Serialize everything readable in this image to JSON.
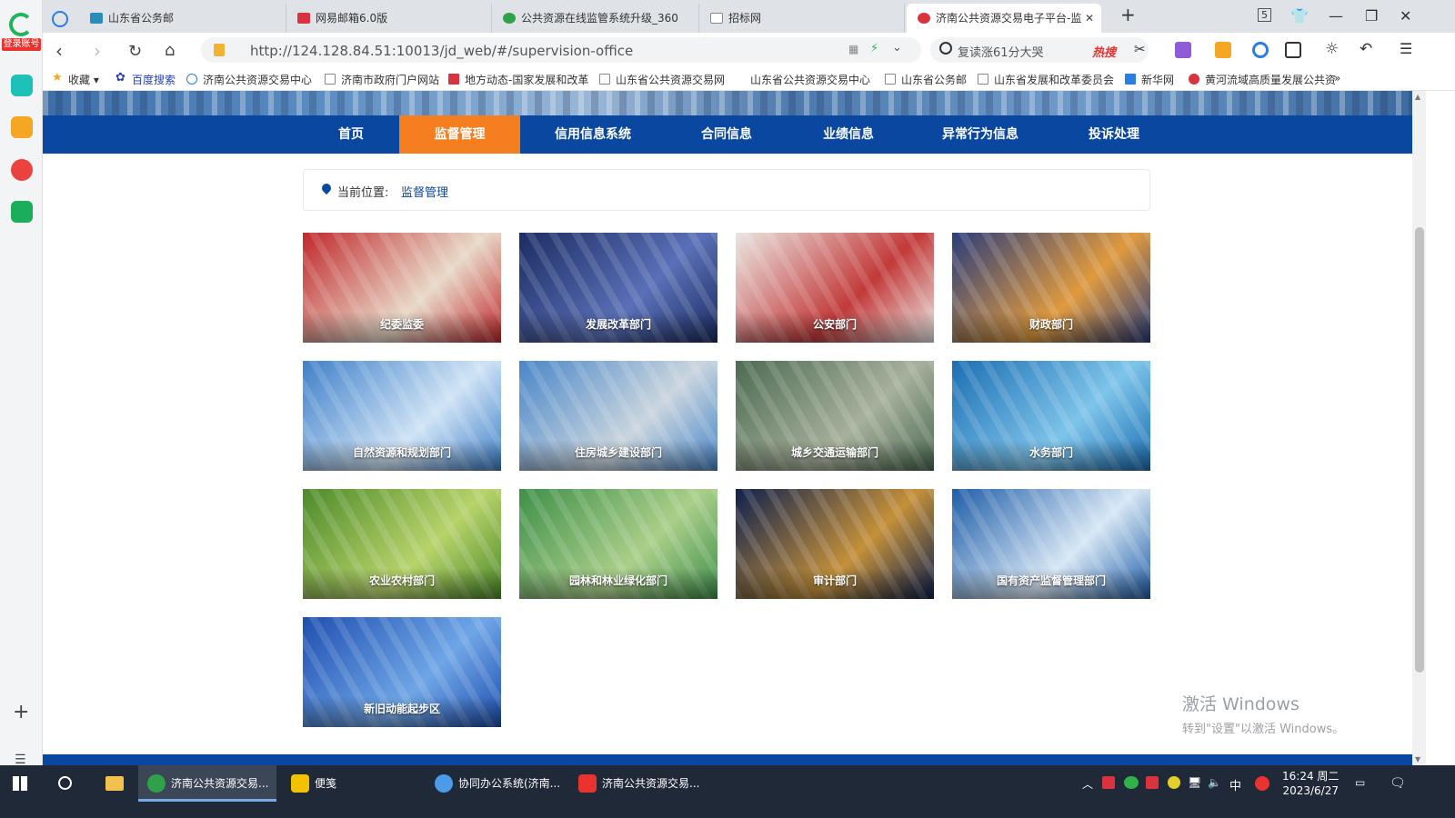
{
  "browser": {
    "login_badge": "登录账号",
    "tabs": [
      {
        "title": "山东省公务邮",
        "active": false,
        "icon_color": "#2a8cb8"
      },
      {
        "title": "网易邮箱6.0版",
        "active": false,
        "icon_color": "#d9333f"
      },
      {
        "title": "公共资源在线监管系统升级_360",
        "active": false,
        "icon_color": "#2fa14a"
      },
      {
        "title": "招标网",
        "active": false,
        "icon_color": "#888888"
      },
      {
        "title": "济南公共资源交易电子平台-监",
        "active": true,
        "icon_color": "#d9333f"
      }
    ],
    "tab_count": "5",
    "address": "http://124.128.84.51:10013/jd_web/#/supervision-office",
    "search_text": "复读涨61分大哭",
    "search_hot": "热搜",
    "bookmarks": [
      "收藏",
      "百度搜索",
      "济南公共资源交易中心",
      "济南市政府门户网站",
      "地方动态-国家发展和改革",
      "山东省公共资源交易网",
      "山东省公共资源交易中心",
      "山东省公务邮",
      "山东省发展和改革委员会",
      "新华网",
      "黄河流域高质量发展公共资"
    ],
    "bookmarks_more": "»"
  },
  "nav": {
    "items": [
      {
        "label": "首页",
        "active": false
      },
      {
        "label": "监督管理",
        "active": true
      },
      {
        "label": "信用信息系统",
        "active": false
      },
      {
        "label": "合同信息",
        "active": false
      },
      {
        "label": "业绩信息",
        "active": false
      },
      {
        "label": "异常行为信息",
        "active": false
      },
      {
        "label": "投诉处理",
        "active": false
      }
    ]
  },
  "breadcrumb": {
    "label": "当前位置:",
    "current": "监督管理"
  },
  "departments": [
    {
      "label": "纪委监委",
      "icon": "party-emblem",
      "colors": [
        "#c0282b",
        "#e8d9c8"
      ]
    },
    {
      "label": "发展改革部门",
      "icon": "city-night",
      "colors": [
        "#1b2d63",
        "#5a6fb6"
      ]
    },
    {
      "label": "公安部门",
      "icon": "police-badge",
      "colors": [
        "#eae6e2",
        "#c23a3a"
      ]
    },
    {
      "label": "财政部门",
      "icon": "finance-chart",
      "colors": [
        "#2b3d7a",
        "#e09a3e"
      ]
    },
    {
      "label": "自然资源和规划部门",
      "icon": "wind-turbines",
      "colors": [
        "#3f80c9",
        "#cfe3f5"
      ]
    },
    {
      "label": "住房城乡建设部门",
      "icon": "high-rise",
      "colors": [
        "#4a86c8",
        "#c9d5de"
      ]
    },
    {
      "label": "城乡交通运输部门",
      "icon": "highway",
      "colors": [
        "#4c6b52",
        "#a7b09c"
      ]
    },
    {
      "label": "水务部门",
      "icon": "water-drop",
      "colors": [
        "#1c6fb3",
        "#7ec4ea"
      ]
    },
    {
      "label": "农业农村部门",
      "icon": "wheat",
      "colors": [
        "#4d8a2a",
        "#b7d36b"
      ]
    },
    {
      "label": "园林和林业绿化部门",
      "icon": "bridge-willow",
      "colors": [
        "#3f8f4a",
        "#aacf8a"
      ]
    },
    {
      "label": "审计部门",
      "icon": "magnifier",
      "colors": [
        "#10214d",
        "#c4903a"
      ]
    },
    {
      "label": "国有资产监督管理部门",
      "icon": "globe",
      "colors": [
        "#1f5da8",
        "#d7e7f5"
      ]
    },
    {
      "label": "新旧动能起步区",
      "icon": "blue-city",
      "colors": [
        "#1e4fb0",
        "#6fa6e6"
      ]
    }
  ],
  "watermark": {
    "line1": "激活 Windows",
    "line2": "转到\"设置\"以激活 Windows。"
  },
  "taskbar": {
    "items": [
      {
        "label": "济南公共资源交易...",
        "active": true,
        "icon_color": "#2fa14a"
      },
      {
        "label": "便笺",
        "active": false,
        "icon_color": "#f2c200"
      },
      {
        "label": "协同办公系统(济南...",
        "active": false,
        "icon_color": "#4c9be8"
      },
      {
        "label": "济南公共资源交易...",
        "active": false,
        "icon_color": "#e8332f"
      }
    ],
    "ime": "中",
    "time": "16:24 周二",
    "date": "2023/6/27"
  }
}
